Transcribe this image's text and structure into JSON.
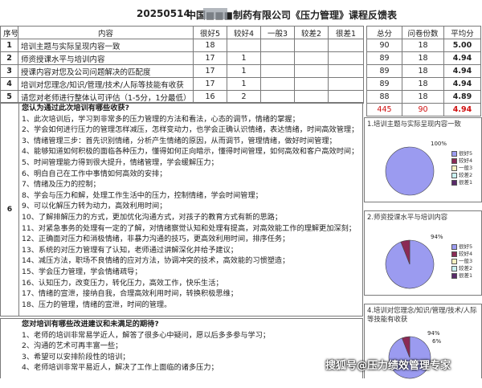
{
  "header": {
    "date": "20250514",
    "title": "中国■■■制药有限公司《压力管理》课程反馈表"
  },
  "table": {
    "headers": [
      "序号",
      "内容",
      "很好5",
      "较好4",
      "一般3",
      "较差2",
      "很差1"
    ],
    "rows": [
      {
        "num": "1",
        "content": "培训主题与实际呈现内容一致",
        "v5": "18",
        "v4": "",
        "v3": "",
        "v2": "",
        "v1": ""
      },
      {
        "num": "2",
        "content": "师资授课水平与培训内容",
        "v5": "17",
        "v4": "1",
        "v3": "",
        "v2": "",
        "v1": ""
      },
      {
        "num": "3",
        "content": "授课内容对您及公司问题解决的匹配度",
        "v5": "17",
        "v4": "1",
        "v3": "",
        "v2": "",
        "v1": ""
      },
      {
        "num": "4",
        "content": "培训对您理念/知识/管理/技术/人际等技能有收获",
        "v5": "17",
        "v4": "1",
        "v3": "",
        "v2": "",
        "v1": ""
      },
      {
        "num": "5",
        "content": "请您对老师进行整体认可评估（1-5分，1分最低）",
        "v5": "16",
        "v4": "2",
        "v3": "",
        "v2": "",
        "v1": ""
      }
    ]
  },
  "summary": {
    "headers": [
      "总分",
      "问卷份数",
      "平均分"
    ],
    "rows": [
      {
        "total": "90",
        "count": "18",
        "avg": "5.00"
      },
      {
        "total": "89",
        "count": "18",
        "avg": "4.94"
      },
      {
        "total": "89",
        "count": "18",
        "avg": "4.94"
      },
      {
        "total": "89",
        "count": "18",
        "avg": "4.94"
      },
      {
        "total": "88",
        "count": "18",
        "avg": "4.89"
      }
    ],
    "totals": {
      "total": "445",
      "count": "90",
      "avg": "4.94"
    }
  },
  "section6": {
    "num": "6",
    "question": "您认为通过此次培训有哪些收获?",
    "items": [
      "1、此次培训后，学习到非常多的压力管理的方法和看法，心态的调节，情绪的掌握；",
      "2、学会如何进行压力的管理怎样减压，怎样变动力，也学会正确认识情绪，表达情绪，时间高效管理；",
      "3、情绪管理三步：首先识别情绪，分析产生情绪的原因，从而调节，管理情绪，做好时间管理；",
      "4、能够知道如何积极的面临各种压力，懂得如何正向暗示，懂得时间管理，如何高效和客户高效时间；",
      "5、时间管理能力得到很大提升，情绪管理，学会缓解压力；",
      "6、明白自己在工作中事情如何高效的安排；",
      "7、情绪及压力的控制；",
      "8、学会与压力和解，处理工作生活中的压力，控制情绪，学会时间管理；",
      "9、可以化解压力转为动力，高效利用时间；",
      "10、了解排解压力的方式，更加优化沟通方式，对孩子的教育方式有新的思路；",
      "11、对紧急事务的处理有一定的了解，对情绪察觉认知和处理有提高，对高效能工作的理解更加深刻；",
      "12、正确面对压力和消极情绪，非暴力沟通的技巧，更高效利用时间，排序任务；",
      "13、系统的对压力管理有了认知，老师通过讲解深化并给予建议；",
      "14、减压方法，职场不良情绪的应对方法，协调冲突的技术，高效能的习惯塑造；",
      "15、学会压力管理，学会情绪疏导；",
      "16、认知压力，改变压力，转化压力，高效工作，快乐生活；",
      "17、情绪的宣泄，接纳自我，合理高效利用时间，转换积极思维；",
      "18、压力的管理，情绪的宣泄，时间的管理。"
    ]
  },
  "section7": {
    "question": "您对培训有哪些改进建议和未满足的期待?",
    "items": [
      "1、老师的培训非常易学近人，解答了很多心中疑问，愿以后多多参与学习；",
      "2、沟通的艺术可再丰富一些；",
      "3、希望可以安排阶段性的培训；",
      "4、老师培训非常平易近人，解决了工作上面临的诸多压力；"
    ]
  },
  "charts": [
    {
      "title": "1.培训主题与实际呈现内容一致",
      "type": "pie",
      "slices": [
        {
          "label": "很好5",
          "value": 100
        }
      ],
      "data_labels": [
        "100%"
      ],
      "legend": [
        "很好5",
        "较好4",
        "一般3",
        "较差2",
        "很差1"
      ]
    },
    {
      "title": "2.师资授课水平与培训内容",
      "type": "pie",
      "slices": [
        {
          "label": "很好5",
          "value": 94
        },
        {
          "label": "较好4",
          "value": 6
        }
      ],
      "data_labels": [
        "94%"
      ],
      "legend": [
        "很好5",
        "较好4",
        "一般3",
        "较差2",
        "很差1"
      ]
    },
    {
      "title": "4.培训对您理念/知识/管理/技术/人际等技能有收获",
      "type": "pie",
      "slices": [
        {
          "label": "很好5",
          "value": 94
        },
        {
          "label": "较好4",
          "value": 6
        }
      ],
      "data_labels": [
        "94%",
        "6%"
      ],
      "legend": []
    }
  ],
  "colors": {
    "pie_main": "#9b9bf0",
    "pie_second": "#8b2a55",
    "accent_red": "#d01010"
  },
  "legend_colors": [
    "#9b9bf0",
    "#8b2a55",
    "#f5f0c0",
    "#c8f0f0",
    "#5a2a6a"
  ],
  "watermark": "搜狐号@压力绩效管理专家"
}
